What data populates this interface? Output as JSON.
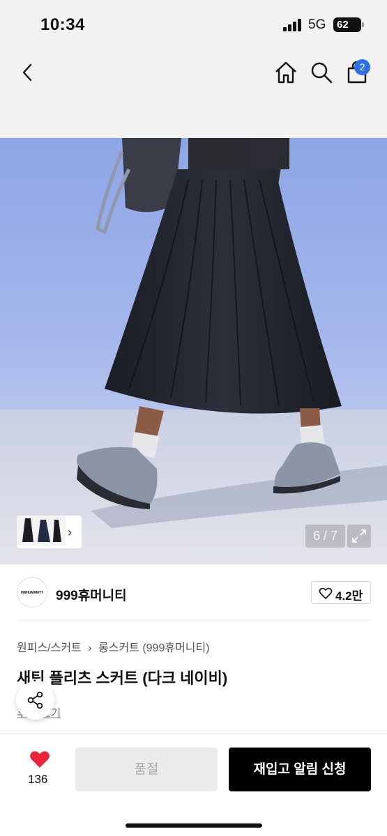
{
  "status_bar": {
    "time": "10:34",
    "network": "5G",
    "battery": "62"
  },
  "nav": {
    "cart_count": "2",
    "icons": [
      "chevron-left-icon",
      "home-icon",
      "search-icon",
      "shopping-bag-icon"
    ]
  },
  "gallery": {
    "counter": "6 / 7",
    "thumb_arrow": "›"
  },
  "brand": {
    "logo_text": "999HUMANITY",
    "name": "999휴머니티",
    "likes": "4.2만"
  },
  "breadcrumb": {
    "items": [
      "원피스/스커트",
      "롱스커트 (999휴머니티)"
    ],
    "separator": "›"
  },
  "product": {
    "title": "새틴 플리츠 스커트 (다크 네이비)",
    "review_link": "후기 보기"
  },
  "bottom": {
    "wish_count": "136",
    "soldout_label": "품절",
    "restock_label": "재입고 알림 신청"
  },
  "colors": {
    "accent_badge": "#2f6fe6",
    "heart_red": "#e8263a",
    "primary_black": "#000000"
  }
}
